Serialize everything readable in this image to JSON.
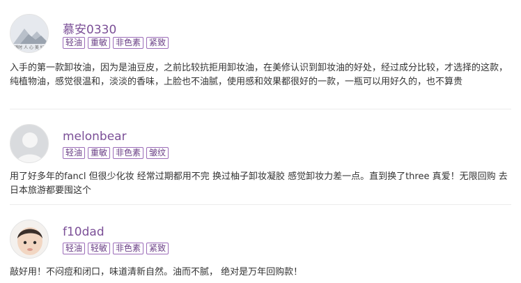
{
  "reviews": [
    {
      "username": "慕安0330",
      "avatar_icon": "mountain-landscape-avatar",
      "avatar_caption": "随时 人 心 美 好",
      "tags": [
        "轻油",
        "重敏",
        "非色素",
        "紧致"
      ],
      "comment": "入手的第一款卸妆油，因为是油豆皮，之前比较抗拒用卸妆油，在美修认识到卸妆油的好处，经过成分比较，才选择的这款，纯植物油，感觉很温和，淡淡的香味，上脸也不油腻，使用感和效果都很好的一款，一瓶可以用好久的，也不算贵"
    },
    {
      "username": "melonbear",
      "avatar_icon": "default-user-avatar",
      "tags": [
        "轻油",
        "重敏",
        "非色素",
        "皱纹"
      ],
      "comment": "用了好多年的fancl 但很少化妆 经常过期都用不完 换过柚子卸妆凝胶 感觉卸妆力差一点。直到换了three 真爱！无限回购 去日本旅游都要囤这个"
    },
    {
      "username": "f10dad",
      "avatar_icon": "child-photo-avatar",
      "tags": [
        "轻油",
        "轻敏",
        "非色素",
        "紧致"
      ],
      "comment": "敲好用！不闷痘和闭口，味道清新自然。油而不腻， 绝对是万年回购款！"
    }
  ],
  "colors": {
    "username": "#7b4f97",
    "tag_border": "#9b6bb8",
    "tag_text": "#6a3f86",
    "text": "#333333",
    "divider": "#ececec"
  }
}
